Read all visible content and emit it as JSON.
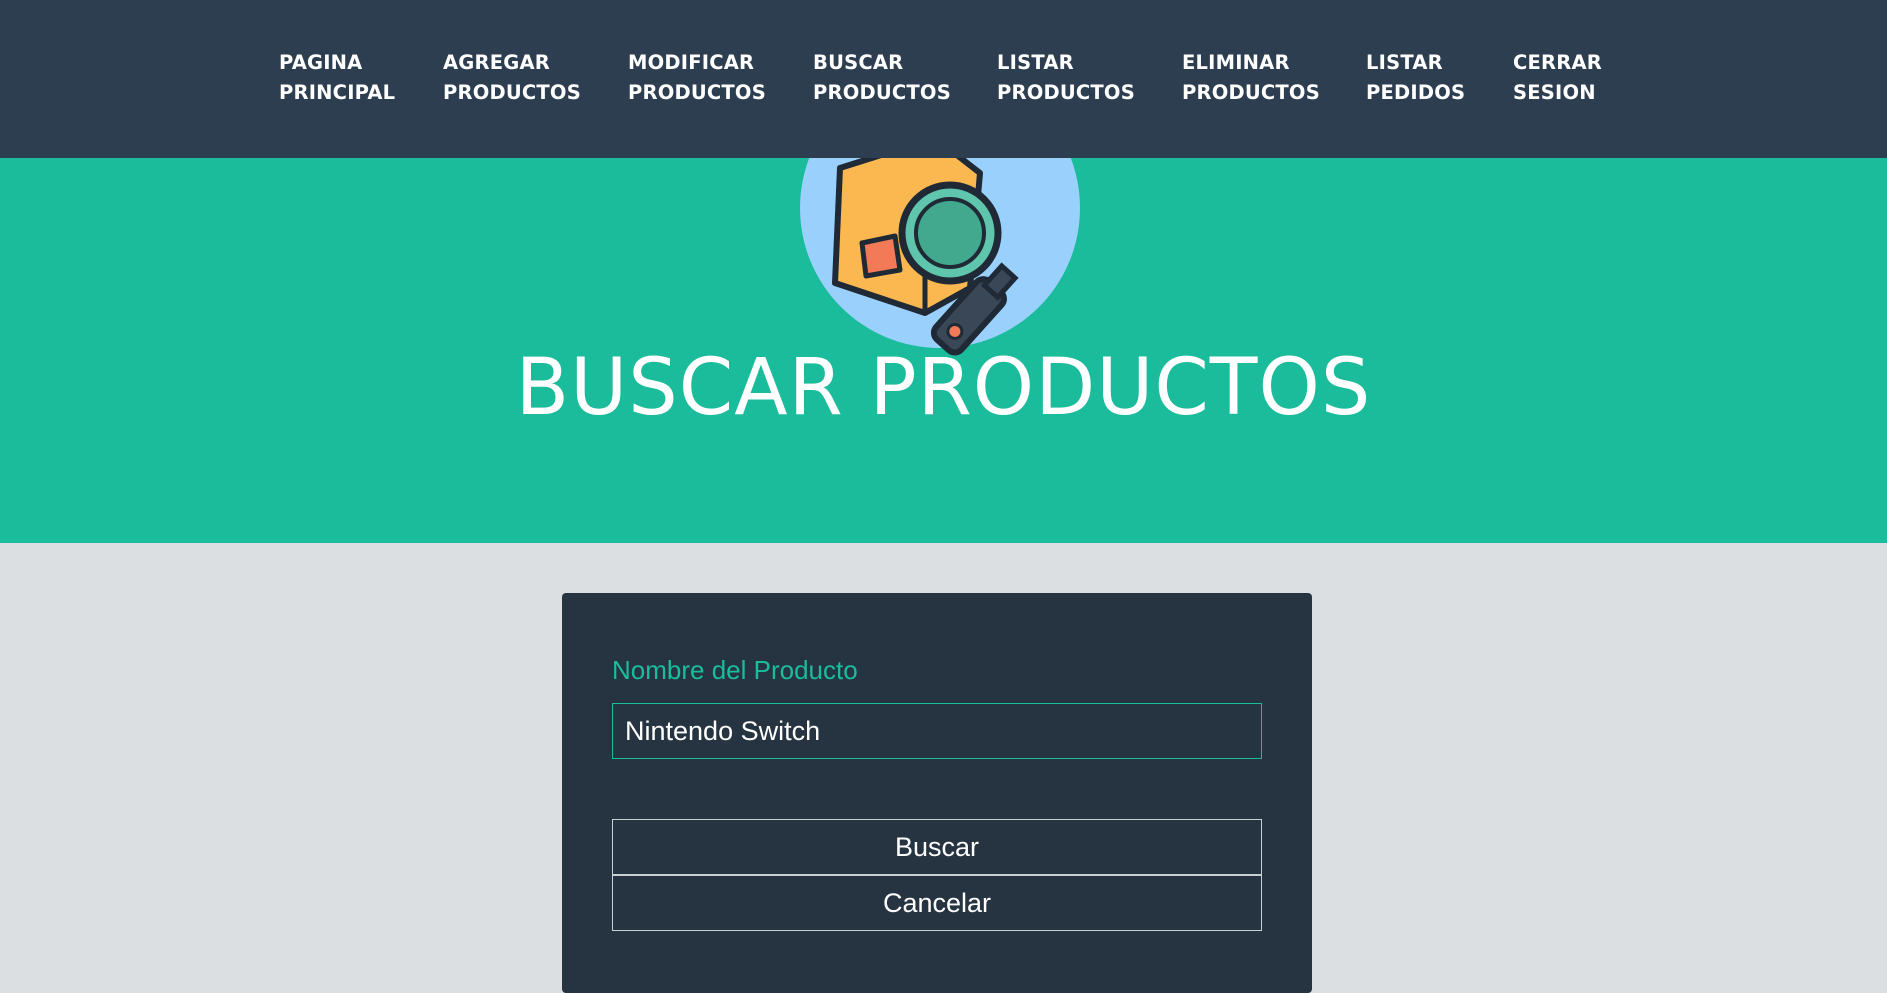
{
  "nav": {
    "items": [
      {
        "line1": "PAGINA",
        "line2": "PRINCIPAL"
      },
      {
        "line1": "AGREGAR",
        "line2": "PRODUCTOS"
      },
      {
        "line1": "MODIFICAR",
        "line2": "PRODUCTOS"
      },
      {
        "line1": "BUSCAR",
        "line2": "PRODUCTOS"
      },
      {
        "line1": "LISTAR",
        "line2": "PRODUCTOS"
      },
      {
        "line1": "ELIMINAR",
        "line2": "PRODUCTOS"
      },
      {
        "line1": "LISTAR",
        "line2": "PEDIDOS"
      },
      {
        "line1": "CERRAR",
        "line2": "SESION"
      }
    ]
  },
  "hero": {
    "icon": "product-search-icon",
    "title": "BUSCAR PRODUCTOS"
  },
  "form": {
    "product_name_label": "Nombre del Producto",
    "product_name_value": "Nintendo Switch",
    "search_button": "Buscar",
    "cancel_button": "Cancelar"
  },
  "colors": {
    "navbar": "#2d3e50",
    "hero": "#1bbc9b",
    "page_background": "#dbdfe1",
    "card": "#263441",
    "accent": "#1bbc9b"
  }
}
